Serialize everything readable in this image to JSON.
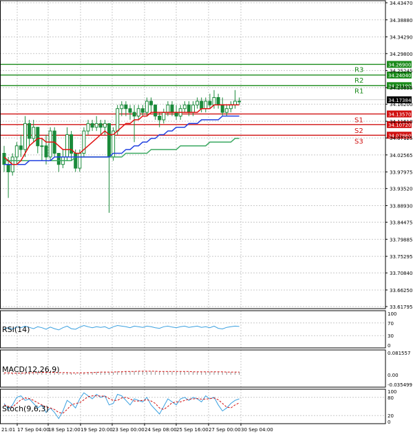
{
  "colors": {
    "background": "#ffffff",
    "grid": "#c8c8c8",
    "candle": "#1a8a3a",
    "ma_fast": "#e01010",
    "ma_mid": "#2040e0",
    "ma_slow": "#3aa860",
    "resistance": "#1a8a1a",
    "support": "#d01010",
    "rsi": "#3aa0e0",
    "macd": "#d01010",
    "stoch_main": "#3aa0e0",
    "stoch_signal": "#d01010",
    "current_price_bg": "#000000"
  },
  "chart_data": {
    "type": "candlestick",
    "main_price_axis": {
      "ylim": [
        33.61795,
        34.4347
      ],
      "tick_labels": [
        "34.43470",
        "34.38880",
        "34.34290",
        "34.29800",
        "34.25245",
        "34.20655",
        "34.16200",
        "34.11610",
        "34.07125",
        "34.02565",
        "33.97975",
        "33.93520",
        "33.88930",
        "33.84475",
        "33.79885",
        "33.75295",
        "33.70840",
        "33.66250",
        "33.61795"
      ],
      "tick_values": [
        34.4347,
        34.3888,
        34.3429,
        34.298,
        34.25245,
        34.20655,
        34.162,
        34.1161,
        34.07125,
        34.02565,
        33.97975,
        33.9352,
        33.8893,
        33.84475,
        33.79885,
        33.75295,
        33.7084,
        33.6625,
        33.61795
      ]
    },
    "current_price": {
      "label": "34.17384",
      "value": 34.17384
    },
    "levels": [
      {
        "name": "R3",
        "value": 34.269,
        "value_label": "34.26900",
        "kind": "resistance"
      },
      {
        "name": "R2",
        "value": 34.2404,
        "value_label": "34.24040",
        "kind": "resistance"
      },
      {
        "name": "R1",
        "value": 34.2119,
        "value_label": "34.21190",
        "kind": "resistance"
      },
      {
        "name": "S1",
        "value": 34.1357,
        "value_label": "34.13570",
        "kind": "support"
      },
      {
        "name": "S2",
        "value": 34.1072,
        "value_label": "34.10720",
        "kind": "support"
      },
      {
        "name": "S3",
        "value": 34.0786,
        "value_label": "34.07860",
        "kind": "support"
      }
    ],
    "x_tick_labels": [
      "21:01",
      "17 Sep 04:00",
      "18 Sep 12:00",
      "19 Sep 20:00",
      "23 Sep 00:00",
      "24 Sep 08:00",
      "25 Sep 16:00",
      "27 Sep 00:00",
      "30 Sep 04:00"
    ],
    "candles": [
      [
        34.03,
        34.05,
        33.98,
        34.0
      ],
      [
        34.0,
        34.02,
        33.91,
        33.98
      ],
      [
        33.98,
        34.03,
        33.97,
        34.02
      ],
      [
        34.02,
        34.06,
        34.0,
        34.05
      ],
      [
        34.05,
        34.08,
        34.02,
        34.04
      ],
      [
        34.04,
        34.13,
        34.02,
        34.11
      ],
      [
        34.11,
        34.12,
        34.05,
        34.07
      ],
      [
        34.07,
        34.12,
        34.06,
        34.1
      ],
      [
        34.1,
        34.1,
        34.03,
        34.05
      ],
      [
        34.05,
        34.07,
        34.01,
        34.05
      ],
      [
        34.05,
        34.08,
        34.0,
        34.02
      ],
      [
        34.02,
        34.1,
        34.01,
        34.09
      ],
      [
        34.09,
        34.1,
        34.02,
        34.03
      ],
      [
        34.03,
        34.03,
        33.98,
        34.0
      ],
      [
        34.0,
        34.04,
        33.99,
        34.02
      ],
      [
        34.02,
        34.1,
        34.01,
        34.08
      ],
      [
        34.08,
        34.09,
        34.01,
        34.03
      ],
      [
        34.03,
        34.04,
        33.98,
        33.99
      ],
      [
        33.99,
        34.04,
        33.98,
        34.03
      ],
      [
        34.03,
        34.1,
        34.02,
        34.09
      ],
      [
        34.09,
        34.12,
        34.08,
        34.11
      ],
      [
        34.11,
        34.12,
        34.09,
        34.1
      ],
      [
        34.1,
        34.13,
        34.09,
        34.11
      ],
      [
        34.11,
        34.12,
        34.08,
        34.1
      ],
      [
        34.1,
        34.12,
        34.08,
        34.11
      ],
      [
        34.11,
        34.11,
        33.87,
        34.02
      ],
      [
        34.02,
        34.1,
        34.01,
        34.09
      ],
      [
        34.09,
        34.16,
        34.08,
        34.15
      ],
      [
        34.15,
        34.17,
        34.13,
        34.16
      ],
      [
        34.16,
        34.17,
        34.13,
        34.15
      ],
      [
        34.15,
        34.16,
        34.12,
        34.14
      ],
      [
        34.14,
        34.16,
        34.06,
        34.13
      ],
      [
        34.13,
        34.16,
        34.12,
        34.15
      ],
      [
        34.15,
        34.16,
        34.13,
        34.14
      ],
      [
        34.14,
        34.18,
        34.13,
        34.17
      ],
      [
        34.17,
        34.18,
        34.14,
        34.16
      ],
      [
        34.16,
        34.16,
        34.12,
        34.13
      ],
      [
        34.13,
        34.14,
        34.1,
        34.12
      ],
      [
        34.12,
        34.15,
        34.11,
        34.14
      ],
      [
        34.14,
        34.17,
        34.13,
        34.16
      ],
      [
        34.16,
        34.17,
        34.13,
        34.14
      ],
      [
        34.14,
        34.16,
        34.12,
        34.13
      ],
      [
        34.13,
        34.16,
        34.12,
        34.15
      ],
      [
        34.15,
        34.17,
        34.14,
        34.16
      ],
      [
        34.16,
        34.17,
        34.13,
        34.14
      ],
      [
        34.14,
        34.17,
        34.13,
        34.16
      ],
      [
        34.16,
        34.18,
        34.15,
        34.17
      ],
      [
        34.17,
        34.18,
        34.14,
        34.15
      ],
      [
        34.15,
        34.18,
        34.14,
        34.17
      ],
      [
        34.17,
        34.19,
        34.15,
        34.16
      ],
      [
        34.16,
        34.2,
        34.15,
        34.18
      ],
      [
        34.18,
        34.19,
        34.15,
        34.16
      ],
      [
        34.16,
        34.18,
        34.13,
        34.14
      ],
      [
        34.14,
        34.16,
        34.13,
        34.15
      ],
      [
        34.15,
        34.17,
        34.14,
        34.16
      ],
      [
        34.16,
        34.2,
        34.15,
        34.17
      ],
      [
        34.17,
        34.18,
        34.16,
        34.17
      ]
    ],
    "ma_fast": [
      34.02,
      34.01,
      34.0,
      34.0,
      34.01,
      34.03,
      34.05,
      34.06,
      34.07,
      34.07,
      34.06,
      34.06,
      34.06,
      34.05,
      34.04,
      34.04,
      34.04,
      34.03,
      34.03,
      34.04,
      34.05,
      34.06,
      34.07,
      34.08,
      34.09,
      34.08,
      34.08,
      34.09,
      34.1,
      34.11,
      34.11,
      34.12,
      34.12,
      34.13,
      34.13,
      34.14,
      34.14,
      34.14,
      34.14,
      34.14,
      34.14,
      34.14,
      34.14,
      34.14,
      34.14,
      34.14,
      34.14,
      34.15,
      34.15,
      34.15,
      34.16,
      34.16,
      34.16,
      34.16,
      34.16,
      34.16,
      34.16
    ],
    "ma_mid": [
      34.0,
      34.0,
      34.0,
      34.0,
      34.0,
      34.0,
      34.01,
      34.01,
      34.01,
      34.01,
      34.01,
      34.01,
      34.02,
      34.02,
      34.02,
      34.02,
      34.02,
      34.02,
      34.02,
      34.02,
      34.02,
      34.02,
      34.02,
      34.02,
      34.02,
      34.02,
      34.03,
      34.03,
      34.03,
      34.04,
      34.04,
      34.05,
      34.05,
      34.06,
      34.06,
      34.07,
      34.07,
      34.08,
      34.08,
      34.09,
      34.09,
      34.1,
      34.1,
      34.1,
      34.11,
      34.11,
      34.11,
      34.12,
      34.12,
      34.12,
      34.12,
      34.12,
      34.13,
      34.13,
      34.13,
      34.13,
      34.13
    ],
    "ma_slow": [
      34.01,
      34.01,
      34.01,
      34.01,
      34.01,
      34.01,
      34.01,
      34.01,
      34.01,
      34.01,
      34.01,
      34.01,
      34.01,
      34.01,
      34.01,
      34.01,
      34.01,
      34.02,
      34.02,
      34.02,
      34.02,
      34.02,
      34.02,
      34.02,
      34.02,
      34.02,
      34.02,
      34.02,
      34.02,
      34.03,
      34.03,
      34.03,
      34.03,
      34.03,
      34.03,
      34.04,
      34.04,
      34.04,
      34.04,
      34.04,
      34.04,
      34.04,
      34.05,
      34.05,
      34.05,
      34.05,
      34.05,
      34.05,
      34.05,
      34.06,
      34.06,
      34.06,
      34.06,
      34.06,
      34.06,
      34.07,
      34.07
    ],
    "rsi": {
      "label": "RSI(14)",
      "ticks": [
        "100",
        "70",
        "30",
        "0"
      ],
      "tick_values": [
        100,
        70,
        30,
        0
      ],
      "values": [
        52,
        55,
        50,
        58,
        55,
        60,
        56,
        52,
        58,
        55,
        50,
        57,
        52,
        48,
        55,
        60,
        52,
        50,
        57,
        62,
        58,
        55,
        58,
        56,
        58,
        52,
        58,
        62,
        60,
        58,
        55,
        60,
        58,
        56,
        60,
        58,
        55,
        53,
        58,
        60,
        57,
        55,
        58,
        60,
        56,
        58,
        60,
        56,
        58,
        55,
        60,
        53,
        51,
        56,
        58,
        60,
        59
      ]
    },
    "macd": {
      "label": "MACD(12,26,9)",
      "ticks": [
        "0.081557",
        "0.00",
        "-0.035499"
      ],
      "tick_values": [
        0.081557,
        0.0,
        -0.035499
      ],
      "histogram": [
        0.006,
        0.005,
        0.004,
        0.005,
        0.006,
        0.008,
        0.009,
        0.01,
        0.01,
        0.009,
        0.008,
        0.009,
        0.008,
        0.006,
        0.006,
        0.007,
        0.006,
        0.005,
        0.006,
        0.008,
        0.009,
        0.01,
        0.011,
        0.011,
        0.011,
        0.009,
        0.01,
        0.012,
        0.013,
        0.013,
        0.013,
        0.013,
        0.013,
        0.013,
        0.013,
        0.013,
        0.012,
        0.011,
        0.011,
        0.012,
        0.011,
        0.011,
        0.011,
        0.011,
        0.011,
        0.011,
        0.011,
        0.011,
        0.011,
        0.011,
        0.012,
        0.011,
        0.01,
        0.01,
        0.01,
        0.011,
        0.011
      ],
      "signal": [
        0.007,
        0.007,
        0.006,
        0.006,
        0.006,
        0.007,
        0.007,
        0.008,
        0.008,
        0.009,
        0.009,
        0.009,
        0.009,
        0.008,
        0.008,
        0.008,
        0.007,
        0.007,
        0.007,
        0.007,
        0.008,
        0.008,
        0.009,
        0.01,
        0.01,
        0.01,
        0.01,
        0.011,
        0.011,
        0.012,
        0.012,
        0.012,
        0.013,
        0.013,
        0.013,
        0.013,
        0.013,
        0.012,
        0.012,
        0.012,
        0.012,
        0.012,
        0.012,
        0.012,
        0.012,
        0.011,
        0.011,
        0.011,
        0.011,
        0.011,
        0.011,
        0.011,
        0.011,
        0.01,
        0.01,
        0.01,
        0.01
      ]
    },
    "stoch": {
      "label": "Stoch(9,6,3)",
      "ticks": [
        "100",
        "80",
        "20",
        "0"
      ],
      "tick_values": [
        100,
        80,
        20,
        0
      ],
      "main": [
        60,
        40,
        55,
        80,
        85,
        70,
        75,
        60,
        45,
        55,
        30,
        45,
        30,
        10,
        35,
        70,
        60,
        45,
        75,
        95,
        85,
        75,
        90,
        80,
        85,
        55,
        60,
        90,
        85,
        70,
        55,
        75,
        70,
        65,
        80,
        55,
        40,
        25,
        50,
        75,
        65,
        55,
        75,
        80,
        70,
        80,
        75,
        65,
        85,
        75,
        80,
        55,
        35,
        45,
        60,
        70,
        75
      ],
      "signal": [
        55,
        50,
        48,
        60,
        72,
        78,
        76,
        70,
        62,
        55,
        48,
        45,
        40,
        30,
        28,
        40,
        55,
        60,
        62,
        72,
        82,
        85,
        85,
        84,
        84,
        76,
        70,
        70,
        78,
        80,
        75,
        68,
        68,
        70,
        72,
        68,
        60,
        45,
        40,
        50,
        62,
        65,
        65,
        70,
        74,
        75,
        76,
        74,
        74,
        76,
        78,
        72,
        60,
        48,
        45,
        55,
        62
      ]
    }
  }
}
